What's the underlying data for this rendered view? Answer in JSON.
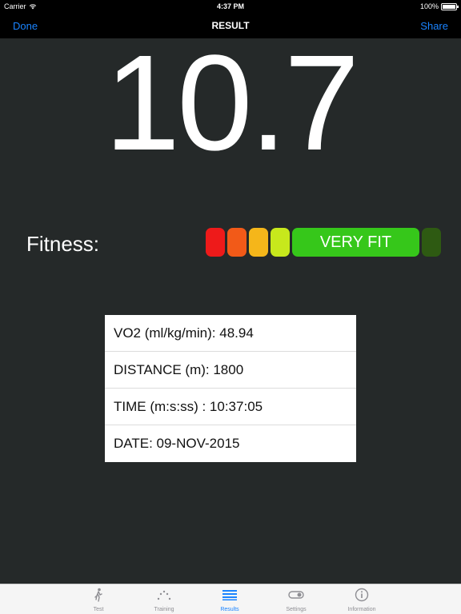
{
  "status_bar": {
    "carrier": "Carrier",
    "time": "4:37 PM",
    "battery": "100%",
    "battery_level": 1.0
  },
  "nav": {
    "left_button": "Done",
    "title": "RESULT",
    "right_button": "Share"
  },
  "score": "10.7",
  "fitness": {
    "label": "Fitness:",
    "level_label": "VERY FIT",
    "levels": [
      {
        "color": "#ee1a1a"
      },
      {
        "color": "#f25a18"
      },
      {
        "color": "#f5b61a"
      },
      {
        "color": "#c7e81c"
      },
      {
        "color": "#36c71a",
        "active": true
      },
      {
        "color": "#2e5a12"
      }
    ]
  },
  "results": [
    "VO2 (ml/kg/min): 48.94",
    "DISTANCE (m): 1800",
    "TIME (m:s:ss) : 10:37:05",
    "DATE: 09-NOV-2015"
  ],
  "tabs": [
    {
      "label": "Test",
      "icon": "runner-icon",
      "active": false
    },
    {
      "label": "Training",
      "icon": "dots-arc-icon",
      "active": false
    },
    {
      "label": "Results",
      "icon": "list-icon",
      "active": true
    },
    {
      "label": "Settings",
      "icon": "toggle-icon",
      "active": false
    },
    {
      "label": "Information",
      "icon": "info-icon",
      "active": false
    }
  ],
  "colors": {
    "background": "#252929",
    "accent": "#1a84ff",
    "bar": "#000000"
  }
}
